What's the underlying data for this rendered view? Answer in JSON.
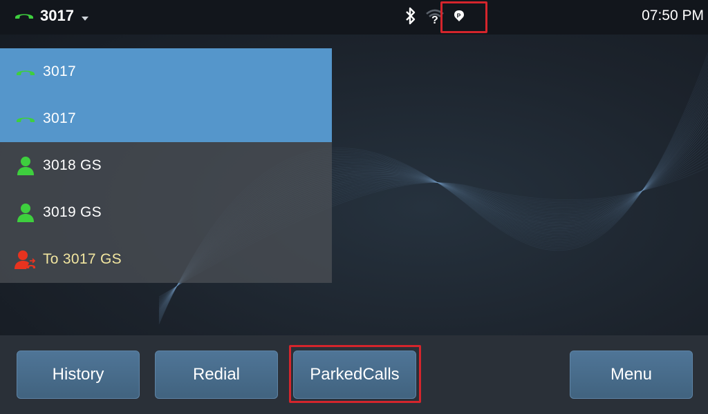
{
  "header": {
    "account_label": "3017",
    "clock": "07:50 PM"
  },
  "status_icons": [
    "bluetooth-icon",
    "wifi-unknown-icon",
    "park-icon"
  ],
  "lines": [
    {
      "label": "3017",
      "type": "active-line",
      "icon": "handset-icon",
      "color": "#3ecf3e"
    },
    {
      "label": "3017",
      "type": "active-line",
      "icon": "handset-icon",
      "color": "#3ecf3e"
    },
    {
      "label": "3018 GS",
      "type": "contact",
      "icon": "contact-icon",
      "color": "#3ecf3e"
    },
    {
      "label": "3019 GS",
      "type": "contact",
      "icon": "contact-icon",
      "color": "#3ecf3e"
    },
    {
      "label": "To 3017 GS",
      "type": "transfer",
      "icon": "contact-transfer-icon",
      "color": "#e8331f"
    }
  ],
  "softkeys": {
    "history": "History",
    "redial": "Redial",
    "parked_calls": "ParkedCalls",
    "menu": "Menu"
  },
  "colors": {
    "accent_green": "#3ecf3e",
    "highlight_red": "#d5252c",
    "active_row": "#5596cb",
    "transfer_text": "#f2e6a0"
  }
}
